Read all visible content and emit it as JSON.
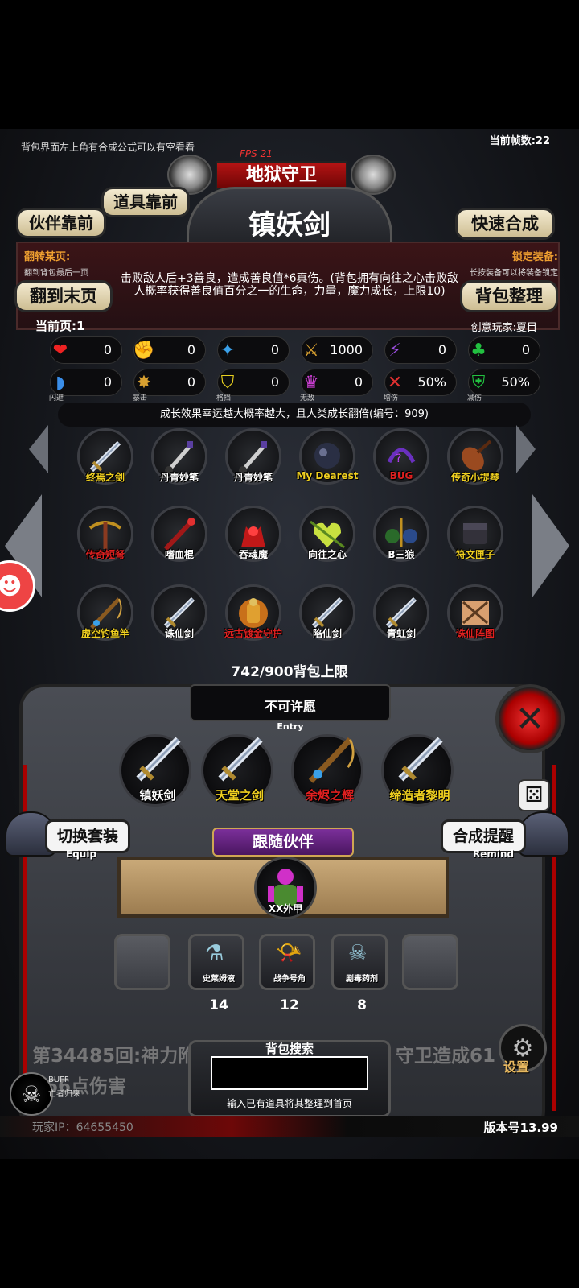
{
  "top_hint": "背包界面左上角有合成公式可以有空看看",
  "frame_count": "当前帧数:22",
  "fps": "FPS 21",
  "boss_name": "地狱守卫",
  "item_title": "镇妖剑",
  "buttons": {
    "items_front": "道具靠前",
    "partner_front": "伙伴靠前",
    "quick_craft": "快速合成",
    "last_page": "翻到末页",
    "sort_bag": "背包整理"
  },
  "flip_page": {
    "title": "翻转某页:",
    "sub": "翻到背包最后一页"
  },
  "lock_equip": {
    "title": "锁定装备:",
    "sub": "长按装备可以将装备锁定"
  },
  "description": "击败敌人后+3善良，造成善良值*6真伤。(背包拥有向往之心击败敌人概率获得善良值百分之一的生命，力量，魔力成长，上限10)",
  "current_page": "当前页:1",
  "creator": "创意玩家:夏目",
  "stats_row1": [
    {
      "icon": "heart-icon",
      "glyph": "❤",
      "color": "#e22",
      "value": "0",
      "caption": ""
    },
    {
      "icon": "strength-icon",
      "glyph": "✊",
      "color": "#e8c020",
      "value": "0",
      "caption": ""
    },
    {
      "icon": "magic-icon",
      "glyph": "✦",
      "color": "#3aa0e8",
      "value": "0",
      "caption": ""
    },
    {
      "icon": "attack-icon",
      "glyph": "⚔",
      "color": "#d8a030",
      "value": "1000",
      "caption": ""
    },
    {
      "icon": "lightning-icon",
      "glyph": "⚡",
      "color": "#9b4de0",
      "value": "0",
      "caption": ""
    },
    {
      "icon": "clover-icon",
      "glyph": "♣",
      "color": "#22c040",
      "value": "0",
      "caption": ""
    }
  ],
  "stats_row2": [
    {
      "icon": "dodge-icon",
      "glyph": "◗",
      "color": "#3a8de8",
      "value": "0",
      "caption": "闪避"
    },
    {
      "icon": "crit-icon",
      "glyph": "✸",
      "color": "#d8a030",
      "value": "0",
      "caption": "暴击"
    },
    {
      "icon": "block-icon",
      "glyph": "⛉",
      "color": "#e8d020",
      "value": "0",
      "caption": "格挡"
    },
    {
      "icon": "invincible-icon",
      "glyph": "♛",
      "color": "#d040d8",
      "value": "0",
      "caption": "无敌"
    },
    {
      "icon": "damage-up-icon",
      "glyph": "✕",
      "color": "#e03030",
      "value": "50%",
      "caption": "增伤"
    },
    {
      "icon": "damage-down-icon",
      "glyph": "⛨",
      "color": "#22c040",
      "value": "50%",
      "caption": "减伤"
    }
  ],
  "growth_note": "成长效果幸运越大概率越大，且人类成长翻倍(编号：909)",
  "inventory": [
    {
      "label": "终焉之剑",
      "color": "#f0d020",
      "art": "sword"
    },
    {
      "label": "丹青妙笔",
      "color": "#ffffff",
      "art": "brush"
    },
    {
      "label": "丹青妙笔",
      "color": "#ffffff",
      "art": "brush"
    },
    {
      "label": "My Dearest",
      "color": "#f0d020",
      "art": "orb"
    },
    {
      "label": "BUG",
      "color": "#e02020",
      "art": "bug"
    },
    {
      "label": "传奇小提琴",
      "color": "#f0d020",
      "art": "violin"
    },
    {
      "label": "传奇短弩",
      "color": "#e02020",
      "art": "crossbow"
    },
    {
      "label": "嗜血棍",
      "color": "#ffffff",
      "art": "staff"
    },
    {
      "label": "吞魂魔",
      "color": "#ffffff",
      "art": "demon"
    },
    {
      "label": "向往之心",
      "color": "#ffffff",
      "art": "heart"
    },
    {
      "label": "B三狼",
      "color": "#ffffff",
      "art": "wolf"
    },
    {
      "label": "符文匣子",
      "color": "#f0d020",
      "art": "box"
    },
    {
      "label": "虚空钓鱼竿",
      "color": "#f0d020",
      "art": "rod"
    },
    {
      "label": "诛仙剑",
      "color": "#ffffff",
      "art": "sword"
    },
    {
      "label": "远古镀金守护",
      "color": "#e02020",
      "art": "armor"
    },
    {
      "label": "陷仙剑",
      "color": "#ffffff",
      "art": "sword"
    },
    {
      "label": "青虹剑",
      "color": "#ffffff",
      "art": "sword"
    },
    {
      "label": "诛仙阵图",
      "color": "#e02020",
      "art": "map"
    }
  ],
  "capacity": "742/900背包上限",
  "wish": {
    "title": "不可许愿",
    "sub": "Entry"
  },
  "equipped": [
    {
      "label": "镇妖剑",
      "color": "#ffffff",
      "art": "sword"
    },
    {
      "label": "天堂之剑",
      "color": "#f0d020",
      "art": "sword"
    },
    {
      "label": "余烬之辉",
      "color": "#e02020",
      "art": "rod"
    },
    {
      "label": "缔造者黎明",
      "color": "#f0d020",
      "art": "sword"
    }
  ],
  "switch_set": {
    "label": "切换套装",
    "sub": "Equip"
  },
  "craft_remind": {
    "label": "合成提醒",
    "sub": "Remind"
  },
  "follow_partner": "跟随伙伴",
  "partner": "XX外甲",
  "consumables": [
    {
      "label": "",
      "count": "",
      "empty": true
    },
    {
      "label": "史莱姆液",
      "count": "14",
      "empty": false
    },
    {
      "label": "战争号角",
      "count": "12",
      "empty": false
    },
    {
      "label": "剧毒药剂",
      "count": "8",
      "empty": false
    },
    {
      "label": "",
      "count": "",
      "empty": true
    }
  ],
  "log_line1": "第34485回:神力附",
  "log_line1_tail": "守卫造成61",
  "log_line2": "866点伤害",
  "search": {
    "title": "背包搜索",
    "value": "",
    "hint": "输入已有道具将其整理到首页"
  },
  "buff": {
    "label": "BUFF",
    "sub": "亡者归来"
  },
  "settings": "设置",
  "player_ip": "玩家IP：64655450",
  "version": "版本号13.99",
  "colors": {
    "accent_red": "#b51414",
    "gold": "#f0a030",
    "purple": "#7b2f9a"
  }
}
